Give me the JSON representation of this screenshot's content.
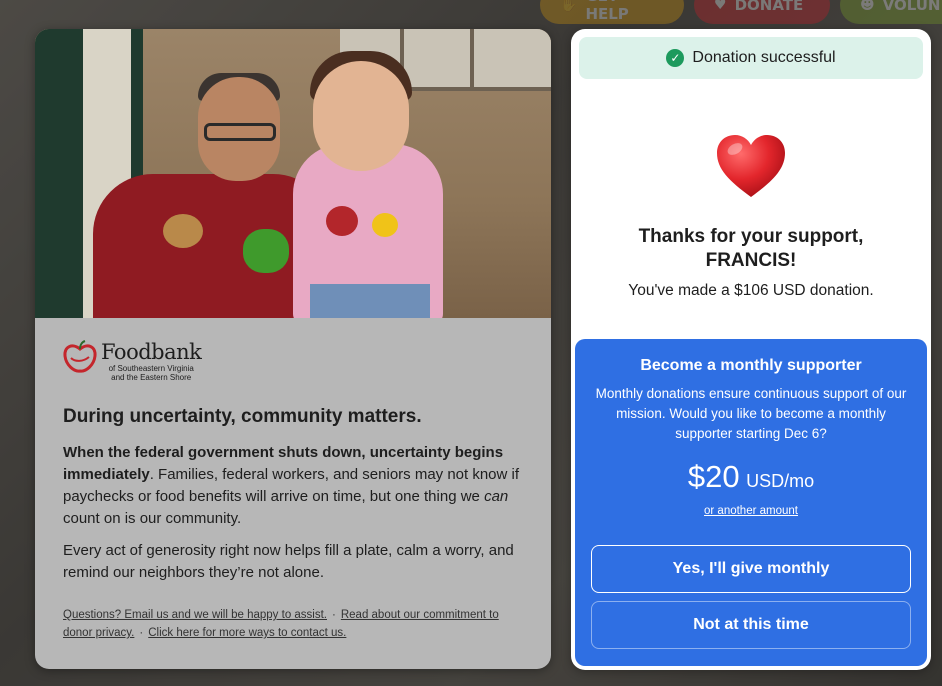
{
  "background_nav": {
    "help_label": "GET HELP",
    "donate_label": "DONATE",
    "volunteer_label": "VOLUN"
  },
  "left_panel": {
    "logo": {
      "name": "Foodbank",
      "subtitle_line1": "of Southeastern Virginia",
      "subtitle_line2": "and the Eastern Shore"
    },
    "title": "During uncertainty, community matters.",
    "para1_bold": "When the federal government shuts down, uncertainty begins immediately",
    "para1_rest": ". Families, federal workers, and seniors may not know if paychecks or food benefits will arrive on time, but one thing we ",
    "para1_italic": "can",
    "para1_end": " count on is our community.",
    "para2": "Every act of generosity right now helps fill a plate, calm a worry, and remind our neighbors they’re not alone.",
    "links": {
      "questions": "Questions? Email us and we will be happy to assist.",
      "privacy": "Read about our commitment to donor privacy.",
      "contact": "Click here for more ways to contact us.",
      "separator": "·"
    }
  },
  "right_panel": {
    "success_text": "Donation successful",
    "thanks_line1": "Thanks for your support,",
    "thanks_line2": "FRANCIS!",
    "donation_text": "You've made a $106 USD donation.",
    "monthly": {
      "title": "Become a monthly supporter",
      "description": "Monthly donations ensure continuous support of our mission. Would you like to become a monthly supporter starting Dec 6?",
      "amount": "$20",
      "unit": "USD/mo",
      "other_amount": "or another amount",
      "yes_button": "Yes, I'll give monthly",
      "no_button": "Not at this time"
    }
  },
  "colors": {
    "accent_blue": "#2f6fe3",
    "success_bg": "#dcf2ea",
    "success_check": "#1d9a5d",
    "heart_red": "#e3262c"
  }
}
